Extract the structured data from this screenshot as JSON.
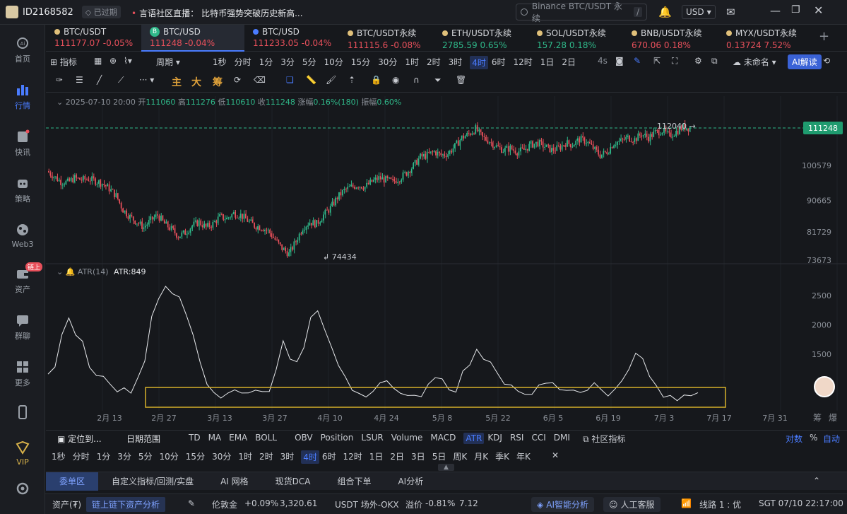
{
  "topbar": {
    "user_id": "ID2168582",
    "expired_badge": "已过期",
    "news_prefix": "言语社区直播：",
    "news_text": "比特币强势突破历史新高...",
    "search_placeholder": "Binance BTC/USDT 永续",
    "search_shortcut": "/",
    "currency": "USD"
  },
  "sidebar": {
    "items": [
      {
        "label": "首页",
        "icon": "home-icon"
      },
      {
        "label": "行情",
        "icon": "market-icon"
      },
      {
        "label": "快讯",
        "icon": "news-icon"
      },
      {
        "label": "策略",
        "icon": "robot-icon"
      },
      {
        "label": "Web3",
        "icon": "web3-icon"
      },
      {
        "label": "资产",
        "icon": "wallet-icon",
        "badge": "链上"
      },
      {
        "label": "群聊",
        "icon": "chat-icon"
      },
      {
        "label": "更多",
        "icon": "grid-icon"
      },
      {
        "label": "",
        "icon": "phone-icon"
      },
      {
        "label": "VIP",
        "icon": "vip-icon"
      },
      {
        "label": "",
        "icon": "settings-icon"
      }
    ]
  },
  "tickers": [
    {
      "name": "BTC/USDT",
      "price": "111177.07",
      "change": "-0.05%",
      "dir": "dn"
    },
    {
      "name": "BTC/USD",
      "price": "111248",
      "change": "-0.04%",
      "dir": "dn"
    },
    {
      "name": "BTC/USD",
      "price": "111233.05",
      "change": "-0.04%",
      "dir": "dn"
    },
    {
      "name": "BTC/USDT永续",
      "price": "111115.6",
      "change": "-0.08%",
      "dir": "dn"
    },
    {
      "name": "ETH/USDT永续",
      "price": "2785.59",
      "change": "0.65%",
      "dir": "up"
    },
    {
      "name": "SOL/USDT永续",
      "price": "157.28",
      "change": "0.18%",
      "dir": "up"
    },
    {
      "name": "BNB/USDT永续",
      "price": "670.06",
      "change": "0.18%",
      "dir": "dn"
    },
    {
      "name": "MYX/USDT永续",
      "price": "0.13724",
      "change": "7.52%",
      "dir": "dn"
    }
  ],
  "toolbar1": {
    "indicator": "指标",
    "period": "周期",
    "intervals": [
      "1秒",
      "分时",
      "1分",
      "3分",
      "5分",
      "10分",
      "15分",
      "30分",
      "1时",
      "2时",
      "3时",
      "4时",
      "6时",
      "12时",
      "1日",
      "2日"
    ],
    "selected": "4时",
    "speed": "4s",
    "layout_name": "未命名",
    "ai_button": "AI解读"
  },
  "toolbar2": {
    "main": "主",
    "big": "大",
    "chip": "筹"
  },
  "ohlc": {
    "datetime": "2025-07-10 20:00",
    "open_label": "开",
    "open": "111060",
    "high_label": "高",
    "high": "111276",
    "low_label": "低",
    "low": "110610",
    "close_label": "收",
    "close": "111248",
    "change_label": "涨幅",
    "change": "0.16%(180)",
    "amp_label": "振幅",
    "amp": "0.60%"
  },
  "atr": {
    "name": "ATR(14)",
    "value": "ATR:849"
  },
  "chart_data": {
    "type": "candlestick",
    "price_axis_ticks": [
      111248,
      100579,
      90665,
      81729,
      73673
    ],
    "current_price": 111248,
    "high_marker": "112040",
    "low_marker": "74434",
    "atr_axis_ticks": [
      2500,
      2000,
      1500
    ],
    "x_ticks": [
      "2月 13",
      "2月 27",
      "3月 13",
      "3月 27",
      "4月 10",
      "4月 24",
      "5月 8",
      "5月 22",
      "6月 5",
      "6月 19",
      "7月 3",
      "7月 17",
      "7月 31"
    ],
    "close_series": [
      99000,
      97500,
      96000,
      95800,
      97000,
      96500,
      96800,
      96200,
      95500,
      94000,
      92000,
      88000,
      86000,
      84500,
      83000,
      85000,
      86500,
      84000,
      82500,
      80500,
      81500,
      83500,
      84500,
      83000,
      84000,
      86000,
      85500,
      87000,
      86500,
      85000,
      83500,
      83000,
      82000,
      79500,
      77000,
      75500,
      79000,
      83000,
      84500,
      84000,
      86500,
      88500,
      91500,
      93500,
      94500,
      95000,
      94500,
      96000,
      97000,
      96500,
      96000,
      97000,
      98500,
      100500,
      103000,
      103500,
      104500,
      103500,
      104000,
      106000,
      108500,
      109500,
      111000,
      108500,
      107500,
      106000,
      105000,
      105500,
      104500,
      105000,
      106500,
      107000,
      106000,
      105000,
      105500,
      107000,
      106500,
      108000,
      107500,
      105500,
      103500,
      104500,
      107000,
      107500,
      108500,
      108000,
      109500,
      108500,
      110000,
      110500,
      109000,
      110200,
      111500,
      111248
    ],
    "atr_series": [
      1150,
      1250,
      1850,
      2150,
      1850,
      1700,
      1300,
      1150,
      1100,
      1000,
      850,
      900,
      800,
      1100,
      1400,
      2150,
      2450,
      2650,
      2550,
      2450,
      2200,
      1800,
      1400,
      1000,
      850,
      750,
      830,
      880,
      820,
      850,
      860,
      900,
      900,
      1250,
      1700,
      1450,
      1350,
      1600,
      2100,
      2250,
      1900,
      1600,
      1300,
      1100,
      900,
      800,
      750,
      840,
      1000,
      1050,
      900,
      850,
      820,
      800,
      800,
      1000,
      1100,
      1050,
      900,
      880,
      1200,
      1300,
      1550,
      1450,
      1350,
      1200,
      1000,
      950,
      880,
      850,
      820,
      950,
      1000,
      1050,
      930,
      900,
      850,
      850,
      870,
      1000,
      900,
      820,
      900,
      1050,
      1200,
      1550,
      1400,
      1100,
      950,
      800,
      770,
      700,
      800,
      780,
      849
    ]
  },
  "indicators": {
    "locate": "定位到...",
    "date_range": "日期范围",
    "overlay": [
      "TD",
      "MA",
      "EMA",
      "BOLL"
    ],
    "sub": [
      "OBV",
      "Position",
      "LSUR",
      "Volume",
      "MACD",
      "ATR",
      "KDJ",
      "RSI",
      "CCI",
      "DMI"
    ],
    "selected": "ATR",
    "community": "社区指标",
    "log": "对数",
    "pct": "%",
    "auto": "自动",
    "filter": "筹",
    "explode": "爆"
  },
  "periods": {
    "items": [
      "1秒",
      "分时",
      "1分",
      "3分",
      "5分",
      "10分",
      "15分",
      "30分",
      "1时",
      "2时",
      "3时",
      "4时",
      "6时",
      "12时",
      "1日",
      "2日",
      "3日",
      "5日",
      "周K",
      "月K",
      "季K",
      "年K"
    ],
    "selected": "4时"
  },
  "bottom_tabs": [
    "委单区",
    "自定义指标/回测/实盘",
    "AI 网格",
    "现货DCA",
    "组合下单",
    "AI分析"
  ],
  "status": {
    "assets_label": "资产(₮)",
    "onchain": "链上链下资产分析",
    "gold_label": "伦敦金",
    "gold_change": "+0.09%",
    "gold_price": "3,320.61",
    "otc_label": "USDT 场外-OKX",
    "premium_label": "溢价",
    "premium": "-0.81%",
    "otc_price": "7.12",
    "ai_smart": "AI智能分析",
    "service": "人工客服",
    "line": "线路 1 : 优",
    "time": "SGT 07/10 22:17:00"
  }
}
